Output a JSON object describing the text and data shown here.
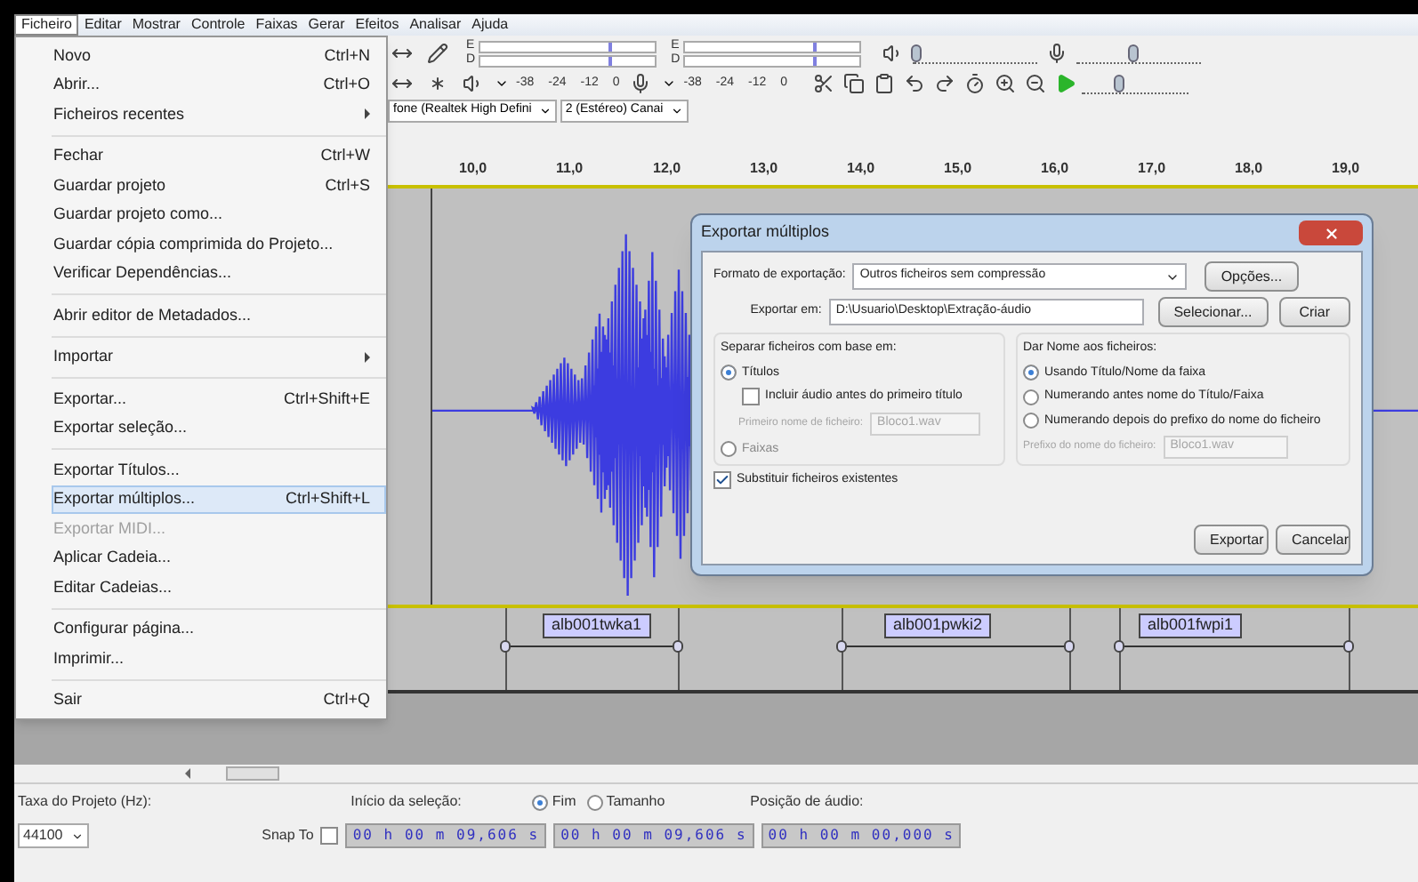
{
  "menu_bar": [
    {
      "label": "Ficheiro",
      "selected": true
    },
    {
      "label": "Editar",
      "selected": false
    },
    {
      "label": "Mostrar",
      "selected": false
    },
    {
      "label": "Controle",
      "selected": false
    },
    {
      "label": "Faixas",
      "selected": false
    },
    {
      "label": "Gerar",
      "selected": false
    },
    {
      "label": "Efeitos",
      "selected": false
    },
    {
      "label": "Analisar",
      "selected": false
    },
    {
      "label": "Ajuda",
      "selected": false
    }
  ],
  "file_menu": {
    "groups": [
      [
        {
          "label": "Novo",
          "shortcut": "Ctrl+N",
          "submenu": false,
          "selected": false,
          "disabled": false
        },
        {
          "label": "Abrir...",
          "shortcut": "Ctrl+O",
          "submenu": false,
          "selected": false,
          "disabled": false
        },
        {
          "label": "Ficheiros recentes",
          "submenu": true,
          "selected": false,
          "disabled": false
        }
      ],
      [
        {
          "label": "Fechar",
          "shortcut": "Ctrl+W",
          "submenu": false,
          "selected": false,
          "disabled": false
        },
        {
          "label": "Guardar projeto",
          "shortcut": "Ctrl+S",
          "submenu": false,
          "selected": false,
          "disabled": false
        },
        {
          "label": "Guardar projeto como...",
          "submenu": false,
          "selected": false,
          "disabled": false
        },
        {
          "label": "Guardar cópia comprimida do Projeto...",
          "submenu": false,
          "selected": false,
          "disabled": false
        },
        {
          "label": "Verificar Dependências...",
          "submenu": false,
          "selected": false,
          "disabled": false
        }
      ],
      [
        {
          "label": "Abrir editor de Metadados...",
          "submenu": false,
          "selected": false,
          "disabled": false
        }
      ],
      [
        {
          "label": "Importar",
          "submenu": true,
          "selected": false,
          "disabled": false
        }
      ],
      [
        {
          "label": "Exportar...",
          "shortcut": "Ctrl+Shift+E",
          "submenu": false,
          "selected": false,
          "disabled": false
        },
        {
          "label": "Exportar seleção...",
          "submenu": false,
          "selected": false,
          "disabled": false
        }
      ],
      [
        {
          "label": "Exportar Títulos...",
          "submenu": false,
          "selected": false,
          "disabled": false
        },
        {
          "label": "Exportar múltiplos...",
          "shortcut": "Ctrl+Shift+L",
          "submenu": false,
          "selected": true,
          "disabled": false
        },
        {
          "label": "Exportar MIDI...",
          "submenu": false,
          "selected": false,
          "disabled": true
        },
        {
          "label": "Aplicar Cadeia...",
          "submenu": false,
          "selected": false,
          "disabled": false
        },
        {
          "label": "Editar Cadeias...",
          "submenu": false,
          "selected": false,
          "disabled": false
        }
      ],
      [
        {
          "label": "Configurar página...",
          "submenu": false,
          "selected": false,
          "disabled": false
        },
        {
          "label": "Imprimir...",
          "submenu": false,
          "selected": false,
          "disabled": false
        }
      ],
      [
        {
          "label": "Sair",
          "shortcut": "Ctrl+Q",
          "submenu": false,
          "selected": false,
          "disabled": false
        }
      ]
    ]
  },
  "toolbar": {
    "meters": [
      {
        "channels": [
          "E",
          "D"
        ],
        "scale": [
          "-38",
          "-24",
          "-12",
          "0"
        ]
      },
      {
        "channels": [
          "E",
          "D"
        ],
        "scale": [
          "-38",
          "-24",
          "-12",
          "0"
        ]
      }
    ],
    "output_volume": {
      "level": 0.03
    },
    "input_volume": {
      "level": 0.45
    },
    "play_speed": {
      "level": 0.35
    },
    "devices": [
      "fone (Realtek High Defini",
      "2 (Estéreo) Canai"
    ]
  },
  "ruler": [
    "10,0",
    "11,0",
    "12,0",
    "13,0",
    "14,0",
    "15,0",
    "16,0",
    "17,0",
    "18,0",
    "19,0"
  ],
  "labels": [
    "alb001twka1",
    "alb001pwki2",
    "alb001fwpi1"
  ],
  "dialog": {
    "title": "Exportar múltiplos",
    "format_label": "Formato de exportação:",
    "format_value": "Outros ficheiros sem compressão",
    "options_button": "Opções...",
    "export_in_label": "Exportar em:",
    "export_in_value": "D:\\Usuario\\Desktop\\Extração-áudio",
    "select_button": "Selecionar...",
    "create_button": "Criar",
    "split_group": {
      "title": "Separar ficheiros com base em:",
      "options": [
        {
          "label": "Títulos",
          "selected": true
        },
        {
          "label": "Faixas",
          "selected": false
        }
      ],
      "include_checkbox": {
        "label": "Incluir áudio antes do primeiro título",
        "checked": false
      },
      "first_name_label": "Primeiro nome de ficheiro:",
      "first_name_value": "Bloco1.wav"
    },
    "name_group": {
      "title": "Dar Nome aos ficheiros:",
      "options": [
        {
          "label": "Usando Título/Nome da faixa",
          "selected": true
        },
        {
          "label": "Numerando antes nome do Título/Faixa",
          "selected": false
        },
        {
          "label": "Numerando depois do prefixo do nome do ficheiro",
          "selected": false
        }
      ],
      "prefix_label": "Prefixo do nome do ficheiro:",
      "prefix_value": "Bloco1.wav"
    },
    "overwrite_checkbox": {
      "label": "Substituir ficheiros existentes",
      "checked": true
    },
    "export_button": "Exportar",
    "cancel_button": "Cancelar"
  },
  "selection_bar": {
    "rate_label": "Taxa do Projeto (Hz):",
    "rate_value": "44100",
    "snap_label": "Snap To",
    "snap_checked": false,
    "start_label": "Início da seleção:",
    "end_modes": [
      {
        "label": "Fim",
        "selected": true
      },
      {
        "label": "Tamanho",
        "selected": false
      }
    ],
    "position_label": "Posição de áudio:",
    "start_value": "00 h 00 m 09,606 s",
    "end_value": "00 h 00 m 09,606 s",
    "position_value": "00 h 00 m 00,000 s"
  }
}
